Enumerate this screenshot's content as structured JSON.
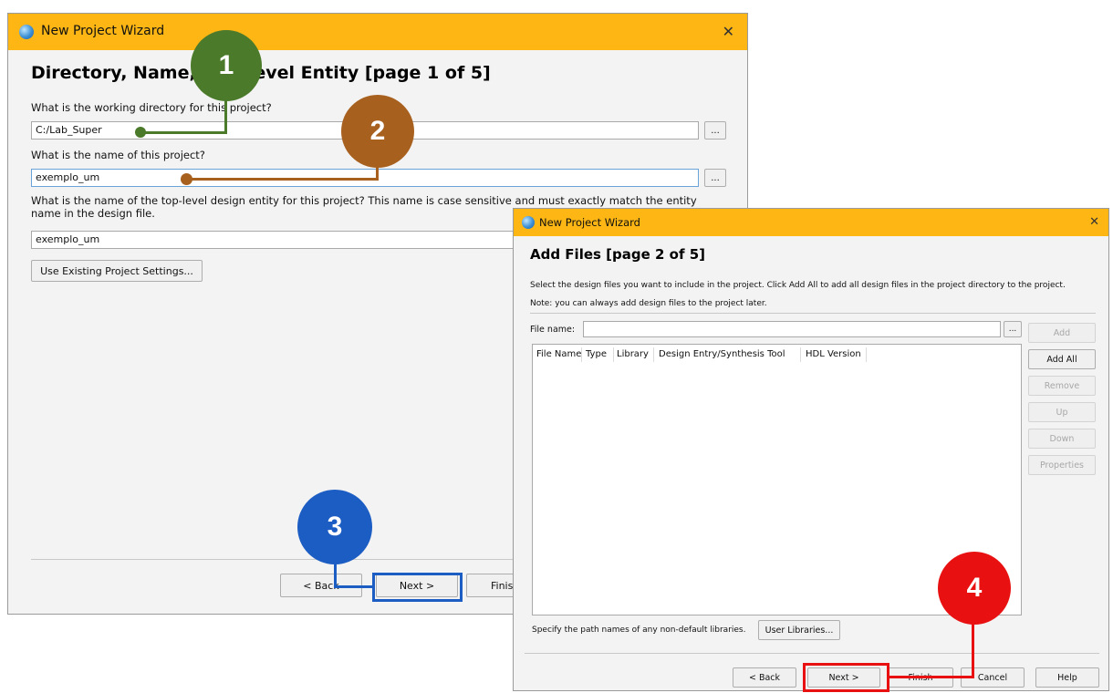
{
  "win1": {
    "title": "New Project Wizard",
    "close": "✕",
    "heading": "Directory, Name, Top-Level Entity [page 1 of 5]",
    "dir_label": "What is the working directory for this project?",
    "dir_value": "C:/Lab_Super",
    "dir_browse": "...",
    "name_label": "What is the name of this project?",
    "name_value": "exemplo_um",
    "name_browse": "...",
    "entity_label": "What is the name of the top-level design entity for this project? This name is case sensitive and must exactly match the entity name in the design file.",
    "entity_value": "exemplo_um",
    "use_existing": "Use Existing Project Settings...",
    "back": "< Back",
    "next": "Next >",
    "finish": "Finish"
  },
  "win2": {
    "title": "New Project Wizard",
    "close": "✕",
    "heading": "Add Files [page 2 of 5]",
    "desc1": "Select the design files you want to include in the project. Click Add All to add all design files in the project directory to the project.",
    "desc2": "Note: you can always add design files to the project later.",
    "file_name_label": "File name:",
    "file_name_value": "",
    "browse": "...",
    "columns": [
      "File Name",
      "Type",
      "Library",
      "Design Entry/Synthesis Tool",
      "HDL Version"
    ],
    "side_buttons": {
      "add": "Add",
      "add_all": "Add All",
      "remove": "Remove",
      "up": "Up",
      "down": "Down",
      "properties": "Properties"
    },
    "libs_label": "Specify the path names of any non-default libraries.",
    "user_libraries": "User Libraries...",
    "back": "< Back",
    "next": "Next >",
    "finish": "Finish",
    "cancel": "Cancel",
    "help": "Help"
  },
  "markers": {
    "m1": "1",
    "m2": "2",
    "m3": "3",
    "m4": "4",
    "colors": {
      "m1": "#4a7a2a",
      "m2": "#a8601e",
      "m3": "#1c5dc4",
      "m4": "#e81010"
    }
  }
}
